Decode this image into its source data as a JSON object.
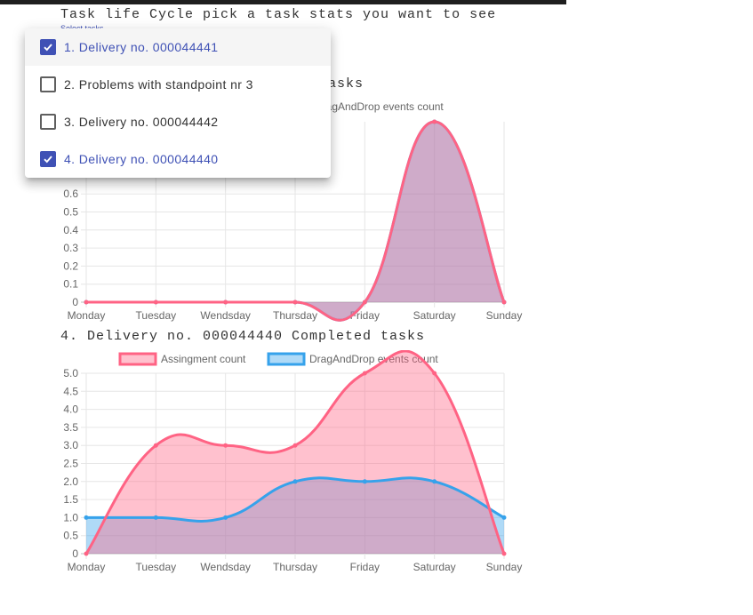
{
  "page": {
    "title": "Task life Cycle pick a task stats you want to see",
    "select_label": "Select tasks"
  },
  "dropdown": {
    "options": [
      {
        "label": "1. Delivery no. 000044441",
        "checked": true
      },
      {
        "label": "2. Problems with standpoint nr 3",
        "checked": false
      },
      {
        "label": "3. Delivery no. 000044442",
        "checked": false
      },
      {
        "label": "4. Delivery no. 000044440",
        "checked": true
      }
    ]
  },
  "colors": {
    "assignment_stroke": "#ff6384",
    "assignment_fill": "rgba(255,99,132,0.4)",
    "dragdrop_stroke": "#36a2eb",
    "dragdrop_fill": "rgba(54,162,235,0.4)",
    "selected_accent": "#3f51b5"
  },
  "chart_data": [
    {
      "type": "area",
      "title": "asks",
      "legend_visible": "DragAndDrop events count",
      "categories": [
        "Monday",
        "Tuesday",
        "Wendsday",
        "Thursday",
        "Friday",
        "Saturday",
        "Sunday"
      ],
      "yticks": [
        "0",
        "0.1",
        "0.2",
        "0.3",
        "0.4",
        "0.5",
        "0.6"
      ],
      "ylim": [
        0,
        1.0
      ],
      "grid": true,
      "series": [
        {
          "name": "Assingment count",
          "values": [
            0,
            0,
            0,
            0,
            0,
            1,
            0
          ]
        },
        {
          "name": "DragAndDrop events count",
          "values": [
            0,
            0,
            0,
            0,
            0,
            1,
            0
          ]
        }
      ]
    },
    {
      "type": "area",
      "title": "4. Delivery no. 000044440 Completed tasks",
      "categories": [
        "Monday",
        "Tuesday",
        "Wendsday",
        "Thursday",
        "Friday",
        "Saturday",
        "Sunday"
      ],
      "yticks": [
        "0",
        "0.5",
        "1.0",
        "1.5",
        "2.0",
        "2.5",
        "3.0",
        "3.5",
        "4.0",
        "4.5",
        "5.0"
      ],
      "ylim": [
        0,
        5.0
      ],
      "grid": true,
      "legend": "top",
      "series": [
        {
          "name": "Assingment count",
          "values": [
            0,
            3,
            3,
            3,
            5,
            5,
            0
          ]
        },
        {
          "name": "DragAndDrop events count",
          "values": [
            1,
            1,
            1,
            2,
            2,
            2,
            1
          ]
        }
      ]
    }
  ]
}
